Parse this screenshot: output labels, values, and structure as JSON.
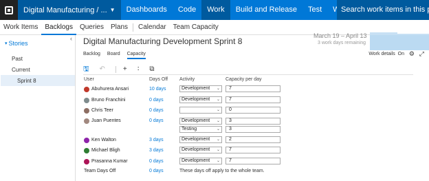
{
  "topbar": {
    "project_name": "Digital Manufacturing / ...",
    "nav": [
      "Dashboards",
      "Code",
      "Work",
      "Build and Release",
      "Test",
      "Wiki"
    ],
    "active_nav": "Work",
    "search_placeholder": "Search work items in this project"
  },
  "subnav": {
    "items": [
      "Work Items",
      "Backlogs",
      "Queries",
      "Plans",
      "Calendar",
      "Team Capacity"
    ],
    "active": "Backlogs"
  },
  "sidebar": {
    "title": "Stories",
    "items": [
      "Past",
      "Current",
      "Sprint 8"
    ],
    "selected": "Sprint 8"
  },
  "sprint": {
    "title": "Digital Manufacturing Development Sprint 8",
    "dates": "March 19 – April 13",
    "remaining": "3 work days remaining"
  },
  "tabs": [
    "Backlog",
    "Board",
    "Capacity"
  ],
  "active_tab": "Capacity",
  "work_details": {
    "label": "Work details",
    "state": "On"
  },
  "table": {
    "headers": {
      "user": "User",
      "days_off": "Days Off",
      "activity": "Activity",
      "capacity": "Capacity per day"
    },
    "rows": [
      {
        "user": "Abuhurera Ansari",
        "days_off": "10 days",
        "activity": "Development",
        "capacity": "7",
        "avatar_color": "#c0392b"
      },
      {
        "user": "Bruno Franchini",
        "days_off": "0 days",
        "activity": "Development",
        "capacity": "7",
        "avatar_color": "#7f8c8d"
      },
      {
        "user": "Chris Teer",
        "days_off": "0 days",
        "activity": "",
        "capacity": "0",
        "avatar_color": "#8d6e63"
      },
      {
        "user": "Juan Puentes",
        "days_off": "0 days",
        "activity": "Development",
        "capacity": "3",
        "avatar_color": "#a1887f"
      },
      {
        "user": "",
        "days_off": "",
        "activity": "Testing",
        "capacity": "3",
        "avatar_color": ""
      },
      {
        "user": "Ken Walton",
        "days_off": "3 days",
        "activity": "Development",
        "capacity": "2",
        "avatar_color": "#8e24aa"
      },
      {
        "user": "Michael Bligh",
        "days_off": "3 days",
        "activity": "Development",
        "capacity": "7",
        "avatar_color": "#2e7d32"
      },
      {
        "user": "Prasanna Kumar",
        "days_off": "0 days",
        "activity": "Development",
        "capacity": "7",
        "avatar_color": "#ad1457"
      }
    ],
    "team_days_off": {
      "label": "Team Days Off",
      "days_off": "0 days",
      "note": "These days off apply to the whole team."
    }
  },
  "colors": {
    "brand": "#0078d7",
    "brand_dark": "#005a9e",
    "selected_bg": "#e5eff9"
  }
}
